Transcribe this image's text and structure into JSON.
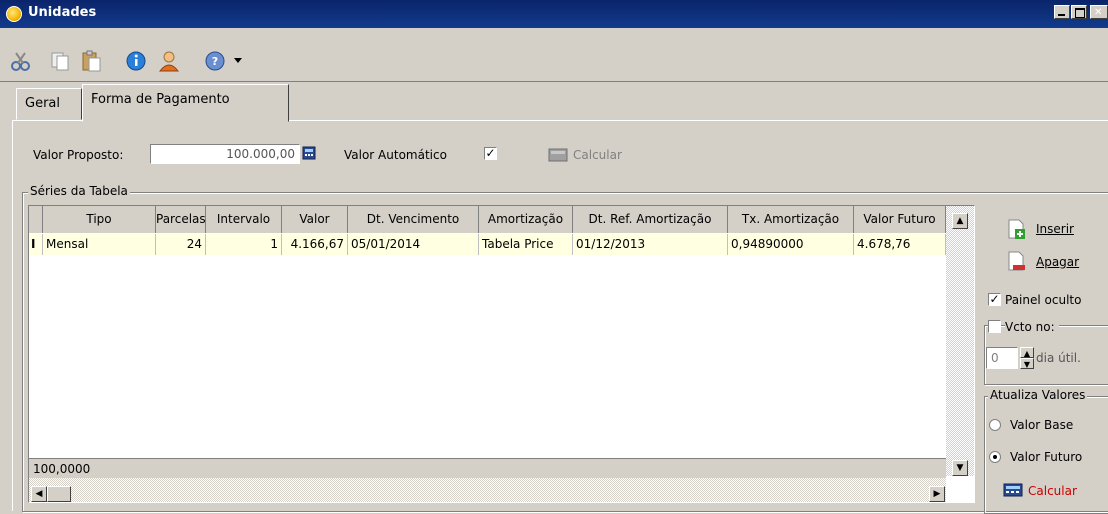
{
  "window": {
    "title": "Unidades"
  },
  "toolbar": {
    "icons": [
      "cut-icon",
      "copy-icon",
      "paste-icon",
      "info-icon",
      "user-icon",
      "help-icon",
      "dropdown-arrow-icon"
    ]
  },
  "tabs": [
    {
      "label": "Geral",
      "active": false
    },
    {
      "label": "Forma de Pagamento",
      "active": true
    }
  ],
  "form": {
    "valor_proposto_label": "Valor Proposto:",
    "valor_proposto_value": "100.000,00",
    "valor_automatico_label": "Valor Automático",
    "valor_automatico_checked": true,
    "calcular_label": "Calcular"
  },
  "series": {
    "group_title": "Séries da Tabela",
    "columns": [
      "Tipo",
      "Parcelas",
      "Intervalo",
      "Valor",
      "Dt. Vencimento",
      "Amortização",
      "Dt. Ref. Amortização",
      "Tx. Amortização",
      "Valor Futuro"
    ],
    "rows": [
      [
        "Mensal",
        "24",
        "1",
        "4.166,67",
        "05/01/2014",
        "Tabela Price",
        "01/12/2013",
        "0,94890000",
        "4.678,76"
      ]
    ],
    "footer_total": "100,0000"
  },
  "side": {
    "inserir_label": "Inserir",
    "apagar_label": "Apagar",
    "painel_oculto_label": "Painel oculto",
    "painel_oculto_checked": true,
    "vcto_no_label": "Vcto no:",
    "vcto_no_checked": false,
    "dia_value": "0",
    "dia_util_label": "dia útil.",
    "atualiza_title": "Atualiza Valores",
    "valor_base_label": "Valor Base",
    "valor_futuro_label": "Valor Futuro",
    "selected_option": "Valor Futuro",
    "calcular_label": "Calcular"
  },
  "colors": {
    "titlebar": "#0a246a",
    "calcular_red": "#cc0000",
    "selected_row": "#ffffe1"
  }
}
